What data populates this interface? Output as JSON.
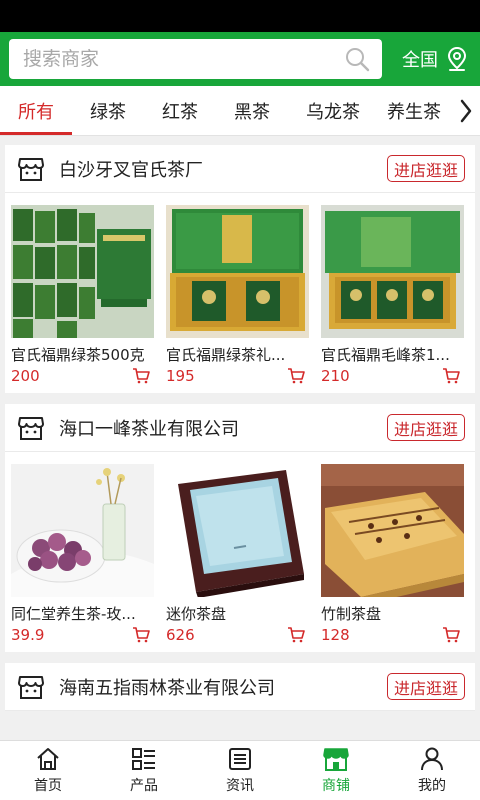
{
  "search": {
    "placeholder": "搜索商家"
  },
  "region": {
    "label": "全国",
    "icon": "location-pin-icon"
  },
  "tabs": [
    {
      "label": "所有",
      "active": true
    },
    {
      "label": "绿茶"
    },
    {
      "label": "红茶"
    },
    {
      "label": "黑茶"
    },
    {
      "label": "乌龙茶"
    },
    {
      "label": "养生茶"
    }
  ],
  "shops": [
    {
      "name": "白沙牙叉官氏茶厂",
      "visit_label": "进店逛逛",
      "products": [
        {
          "name": "官氏福鼎绿茶500克",
          "price": "200",
          "image": "green-tea-bags-image"
        },
        {
          "name": "官氏福鼎绿茶礼...",
          "price": "195",
          "image": "green-tea-gift-box-image"
        },
        {
          "name": "官氏福鼎毛峰茶1...",
          "price": "210",
          "image": "maofeng-tea-gift-box-image"
        }
      ]
    },
    {
      "name": "海口一峰茶业有限公司",
      "visit_label": "进店逛逛",
      "products": [
        {
          "name": "同仁堂养生茶-玫...",
          "price": "39.9",
          "image": "rose-tea-image"
        },
        {
          "name": "迷你茶盘",
          "price": "626",
          "image": "mini-tea-tray-image"
        },
        {
          "name": "竹制茶盘",
          "price": "128",
          "image": "bamboo-tea-tray-image"
        }
      ]
    },
    {
      "name": "海南五指雨林茶业有限公司",
      "visit_label": "进店逛逛",
      "products": []
    }
  ],
  "nav": [
    {
      "label": "首页",
      "icon": "home-icon"
    },
    {
      "label": "产品",
      "icon": "product-list-icon"
    },
    {
      "label": "资讯",
      "icon": "news-icon"
    },
    {
      "label": "商铺",
      "icon": "store-icon",
      "active": true
    },
    {
      "label": "我的",
      "icon": "user-icon"
    }
  ],
  "colors": {
    "brand_green": "#18a63a",
    "accent_red": "#d42a2a"
  }
}
